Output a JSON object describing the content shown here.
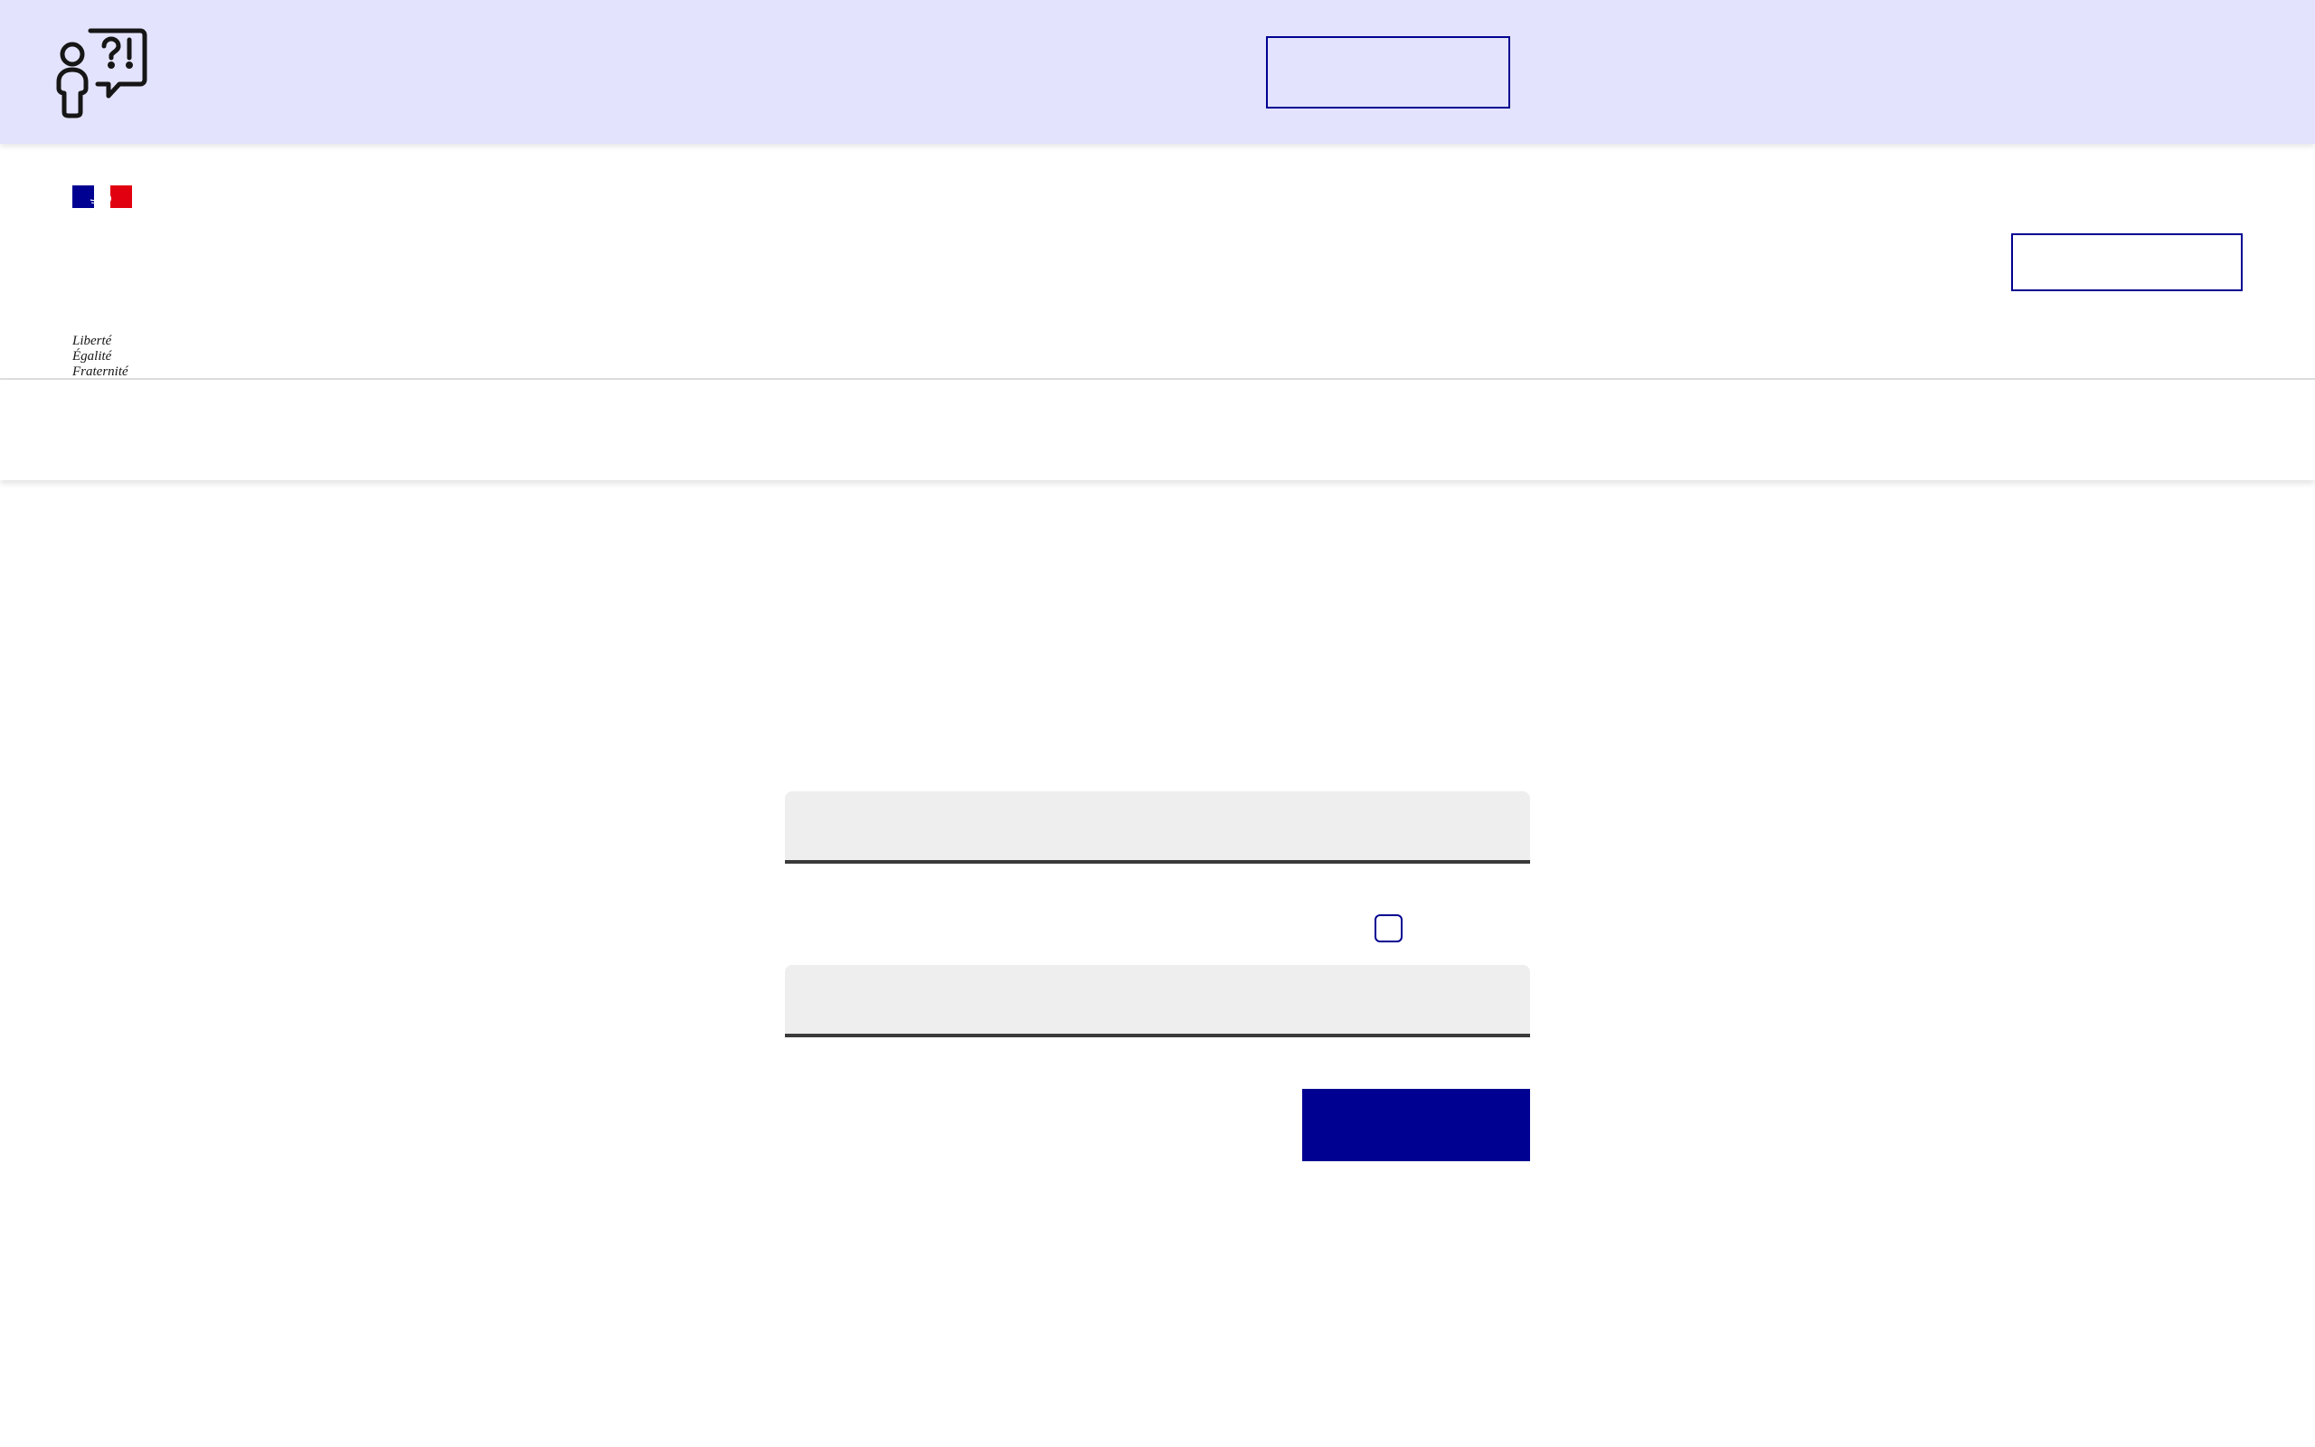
{
  "banner": {
    "icon": "person-question-exclamation-bubble-icon",
    "background_color": "#e3e3fd",
    "button_label": ""
  },
  "header": {
    "logo": {
      "icon": "marianne-flag-logo",
      "motto_line_1": "Liberté",
      "motto_line_2": "Égalité",
      "motto_line_3": "Fraternité"
    },
    "button_label": ""
  },
  "form": {
    "field_1": {
      "value": "",
      "placeholder": ""
    },
    "checkbox": {
      "checked": false
    },
    "field_2": {
      "value": "",
      "placeholder": ""
    },
    "submit_label": ""
  },
  "colors": {
    "accent": "#000091",
    "field_background": "#eeeeee",
    "field_border": "#3a3a3a",
    "flag_red": "#e1000f"
  }
}
